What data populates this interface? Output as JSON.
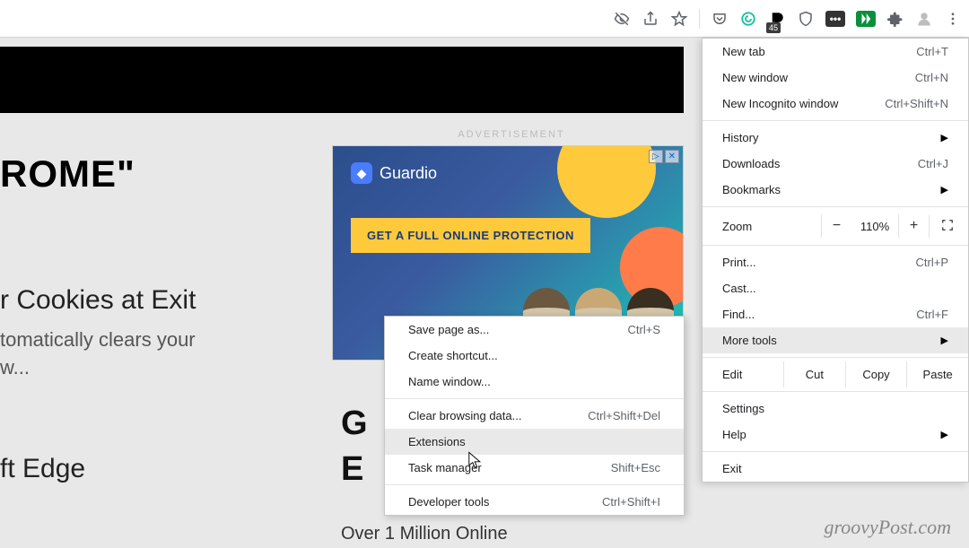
{
  "toolbar": {
    "badge": "45"
  },
  "page": {
    "heading_fragment": "ROME\"",
    "article_title": "r Cookies at Exit",
    "article_body_1": "tomatically clears your",
    "article_body_2": "w...",
    "edge_fragment": "ft Edge",
    "ad_label": "ADVERTISEMENT",
    "ad_brand": "Guardio",
    "ad_cta": "GET A FULL ONLINE PROTECTION",
    "mid_line1": "G",
    "mid_line2": "E",
    "mid_sub": "Over 1 Million Online"
  },
  "menu": {
    "new_tab": "New tab",
    "new_tab_sc": "Ctrl+T",
    "new_window": "New window",
    "new_window_sc": "Ctrl+N",
    "new_incognito": "New Incognito window",
    "new_incognito_sc": "Ctrl+Shift+N",
    "history": "History",
    "downloads": "Downloads",
    "downloads_sc": "Ctrl+J",
    "bookmarks": "Bookmarks",
    "zoom": "Zoom",
    "zoom_pct": "110%",
    "print": "Print...",
    "print_sc": "Ctrl+P",
    "cast": "Cast...",
    "find": "Find...",
    "find_sc": "Ctrl+F",
    "more_tools": "More tools",
    "edit": "Edit",
    "cut": "Cut",
    "copy": "Copy",
    "paste": "Paste",
    "settings": "Settings",
    "help": "Help",
    "exit": "Exit"
  },
  "submenu": {
    "save_as": "Save page as...",
    "save_as_sc": "Ctrl+S",
    "create_shortcut": "Create shortcut...",
    "name_window": "Name window...",
    "clear_data": "Clear browsing data...",
    "clear_data_sc": "Ctrl+Shift+Del",
    "extensions": "Extensions",
    "task_manager": "Task manager",
    "task_manager_sc": "Shift+Esc",
    "dev_tools": "Developer tools",
    "dev_tools_sc": "Ctrl+Shift+I"
  },
  "watermark": "groovyPost.com"
}
